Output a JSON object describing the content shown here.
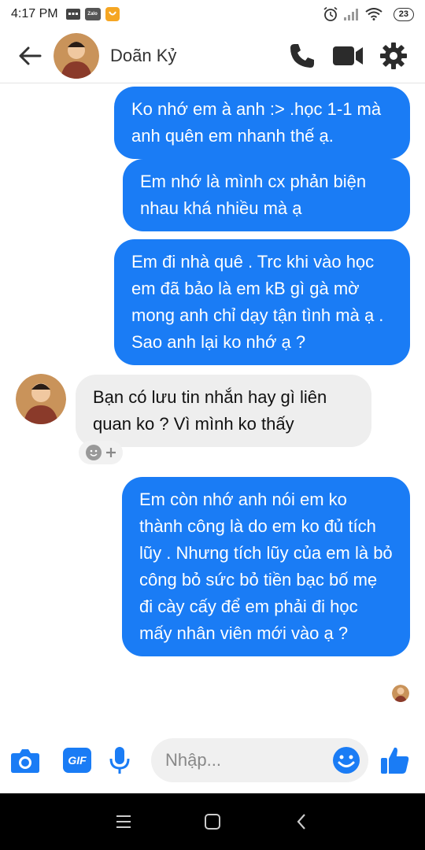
{
  "status_bar": {
    "time": "4:17 PM",
    "battery": "23",
    "notif_zalo": "Zalo"
  },
  "header": {
    "contact_name": "Doãn Kỷ"
  },
  "messages": [
    {
      "from": "me",
      "text": "Ko nhớ em à anh :> .học 1-1 mà anh quên em nhanh thế ạ."
    },
    {
      "from": "me",
      "text": "Em nhớ là mình cx phản biện nhau khá nhiều mà ạ"
    },
    {
      "from": "me",
      "text": "Em đi nhà quê . Trc khi vào học em đã bảo là em kB gì gà mờ mong anh chỉ dạy tận tình mà ạ . Sao anh lại ko nhớ ạ ?"
    },
    {
      "from": "them",
      "text": "Bạn có lưu tin nhắn hay gì liên quan ko ? Vì mình ko thấy"
    },
    {
      "from": "me",
      "text": "Em còn nhớ anh nói em ko thành công là do em ko đủ tích lũy . Nhưng tích lũy của em là bỏ công bỏ sức bỏ tiền bạc bố mẹ đi cày cấy để em phải đi học mấy nhân viên mới vào ạ ?"
    }
  ],
  "composer": {
    "placeholder": "Nhập...",
    "gif_label": "GIF"
  },
  "icons": {
    "back": "back-arrow-icon",
    "call": "phone-icon",
    "video": "video-camera-icon",
    "settings": "gear-icon",
    "camera": "camera-icon",
    "gif": "gif-icon",
    "mic": "microphone-icon",
    "emoji": "smiley-icon",
    "like": "thumbs-up-icon"
  },
  "colors": {
    "accent": "#1a7cf5",
    "incoming_bubble": "#eeeeee"
  }
}
